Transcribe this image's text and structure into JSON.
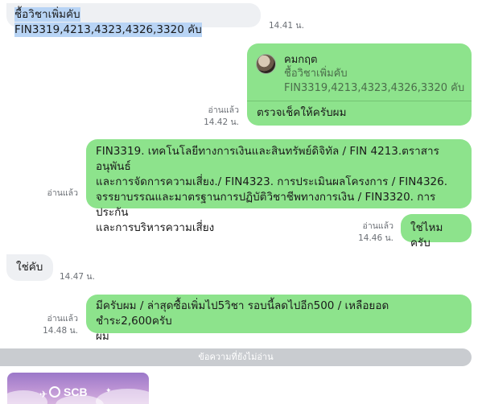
{
  "messages": {
    "m1": {
      "text": "ชื้อวิชาเพิ่มคับ FIN3319,4213,4323,4326,3320 คับ",
      "time": "14.41 น."
    },
    "m2": {
      "reply_name": "คมกฤต",
      "reply_text": "ชื้อวิชาเพิ่มคับ FIN3319,4213,4323,4326,3320 คับ",
      "text": "ตรวจเช็คให้ครับผม",
      "read": "อ่านแล้ว",
      "time": "14.42 น."
    },
    "m3": {
      "lines": [
        "FIN3319. เทคโนโลยีทางการเงินและสินทรัพย์ดิจิทัล / FIN 4213.ตราสารอนุพันธ์",
        "และการจัดการความเสี่ยง./ FIN4323. การประเมินผลโครงการ / FIN4326.",
        "จรรยาบรรณและมาตรฐานการปฏิบัติวิชาชีพทางการเงิน / FIN3320. การประกัน",
        "และการบริหารความเสี่ยง"
      ],
      "read": "อ่านแล้ว"
    },
    "m4": {
      "text": "ใช่ไหมครับ",
      "read": "อ่านแล้ว",
      "time": "14.46 น."
    },
    "m5": {
      "text": "ใช่คับ",
      "time": "14.47 น."
    },
    "m6": {
      "lines": [
        "มีครับผม / ล่าสุดซื้อเพิ่มไป5วิชา รอบนี้ลดไปอีก500 / เหลือยอดชำระ2,600ครับ",
        "ผม"
      ],
      "read": "อ่านแล้ว",
      "time": "14.48 น."
    }
  },
  "unread_bar": "ข้อความที่ยังไม่อ่าน",
  "preview": {
    "brand": "SCB"
  },
  "colors": {
    "outgoing": "#8de38c",
    "incoming": "#eef0f3",
    "selection": "#b8d4f5"
  }
}
